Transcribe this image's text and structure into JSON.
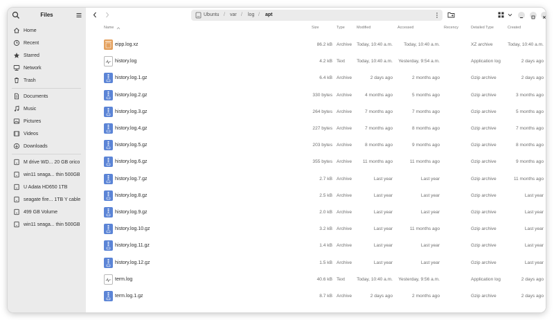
{
  "sidebar": {
    "title": "Files",
    "places": [
      {
        "label": "Home",
        "icon": "home-icon"
      },
      {
        "label": "Recent",
        "icon": "clock-icon"
      },
      {
        "label": "Starred",
        "icon": "star-icon"
      },
      {
        "label": "Network",
        "icon": "network-icon"
      },
      {
        "label": "Trash",
        "icon": "trash-icon"
      }
    ],
    "folders": [
      {
        "label": "Documents",
        "icon": "document-icon"
      },
      {
        "label": "Music",
        "icon": "music-icon"
      },
      {
        "label": "Pictures",
        "icon": "picture-icon"
      },
      {
        "label": "Videos",
        "icon": "video-icon"
      },
      {
        "label": "Downloads",
        "icon": "download-icon"
      }
    ],
    "drives": [
      {
        "label": "M drive WD...   20 GB orico"
      },
      {
        "label": "win11 seaga...   thin 500GB"
      },
      {
        "label": "U Adata HD650 1TB"
      },
      {
        "label": "seagate fire...   1TB Y cable"
      },
      {
        "label": "499 GB Volume"
      },
      {
        "label": "win11 seaga...   thin 500GB"
      }
    ]
  },
  "pathbar": {
    "segments": [
      "Ubuntu",
      "var",
      "log"
    ],
    "current": "apt"
  },
  "columns": {
    "name": "Name",
    "size": "Size",
    "type": "Type",
    "modified": "Modified",
    "accessed": "Accessed",
    "recency": "Recency",
    "detailed_type": "Detailed Type",
    "created": "Created"
  },
  "files": [
    {
      "name": "eipp.log.xz",
      "icon": "xz",
      "size": "86.2 kB",
      "type": "Archive",
      "modified": "Today, 10:40 a.m.",
      "accessed": "Today, 10:40 a.m.",
      "detailed_type": "XZ archive",
      "created": "Today, 10:40 a.m."
    },
    {
      "name": "history.log",
      "icon": "text",
      "size": "4.2 kB",
      "type": "Text",
      "modified": "Today, 10:40 a.m.",
      "accessed": "Yesterday, 9:54 a.m.",
      "detailed_type": "Application log",
      "created": "2 days ago"
    },
    {
      "name": "history.log.1.gz",
      "icon": "gzip",
      "size": "6.4 kB",
      "type": "Archive",
      "modified": "2 days ago",
      "accessed": "2 months ago",
      "detailed_type": "Gzip archive",
      "created": "2 days ago"
    },
    {
      "name": "history.log.2.gz",
      "icon": "gzip",
      "size": "330 bytes",
      "type": "Archive",
      "modified": "4 months ago",
      "accessed": "5 months ago",
      "detailed_type": "Gzip archive",
      "created": "3 months ago"
    },
    {
      "name": "history.log.3.gz",
      "icon": "gzip",
      "size": "264 bytes",
      "type": "Archive",
      "modified": "7 months ago",
      "accessed": "7 months ago",
      "detailed_type": "Gzip archive",
      "created": "5 months ago"
    },
    {
      "name": "history.log.4.gz",
      "icon": "gzip",
      "size": "227 bytes",
      "type": "Archive",
      "modified": "7 months ago",
      "accessed": "8 months ago",
      "detailed_type": "Gzip archive",
      "created": "7 months ago"
    },
    {
      "name": "history.log.5.gz",
      "icon": "gzip",
      "size": "203 bytes",
      "type": "Archive",
      "modified": "8 months ago",
      "accessed": "9 months ago",
      "detailed_type": "Gzip archive",
      "created": "8 months ago"
    },
    {
      "name": "history.log.6.gz",
      "icon": "gzip",
      "size": "355 bytes",
      "type": "Archive",
      "modified": "11 months ago",
      "accessed": "11 months ago",
      "detailed_type": "Gzip archive",
      "created": "9 months ago"
    },
    {
      "name": "history.log.7.gz",
      "icon": "gzip",
      "size": "2.7 kB",
      "type": "Archive",
      "modified": "Last year",
      "accessed": "Last year",
      "detailed_type": "Gzip archive",
      "created": "11 months ago"
    },
    {
      "name": "history.log.8.gz",
      "icon": "gzip",
      "size": "2.5 kB",
      "type": "Archive",
      "modified": "Last year",
      "accessed": "Last year",
      "detailed_type": "Gzip archive",
      "created": "Last year"
    },
    {
      "name": "history.log.9.gz",
      "icon": "gzip",
      "size": "2.0 kB",
      "type": "Archive",
      "modified": "Last year",
      "accessed": "Last year",
      "detailed_type": "Gzip archive",
      "created": "Last year"
    },
    {
      "name": "history.log.10.gz",
      "icon": "gzip",
      "size": "3.2 kB",
      "type": "Archive",
      "modified": "Last year",
      "accessed": "11 months ago",
      "detailed_type": "Gzip archive",
      "created": "Last year"
    },
    {
      "name": "history.log.11.gz",
      "icon": "gzip",
      "size": "1.4 kB",
      "type": "Archive",
      "modified": "Last year",
      "accessed": "Last year",
      "detailed_type": "Gzip archive",
      "created": "Last year"
    },
    {
      "name": "history.log.12.gz",
      "icon": "gzip",
      "size": "1.5 kB",
      "type": "Archive",
      "modified": "Last year",
      "accessed": "Last year",
      "detailed_type": "Gzip archive",
      "created": "Last year"
    },
    {
      "name": "term.log",
      "icon": "text",
      "size": "40.6 kB",
      "type": "Text",
      "modified": "Today, 10:40 a.m.",
      "accessed": "Yesterday, 9:56 a.m.",
      "detailed_type": "Application log",
      "created": "2 days ago"
    },
    {
      "name": "term.log.1.gz",
      "icon": "gzip",
      "size": "8.7 kB",
      "type": "Archive",
      "modified": "2 days ago",
      "accessed": "2 months ago",
      "detailed_type": "Gzip archive",
      "created": "2 days ago"
    }
  ],
  "colors": {
    "gzip_icon": "#5b84d6",
    "xz_icon": "#e4a15f",
    "sidebar_bg": "#ebebeb"
  }
}
